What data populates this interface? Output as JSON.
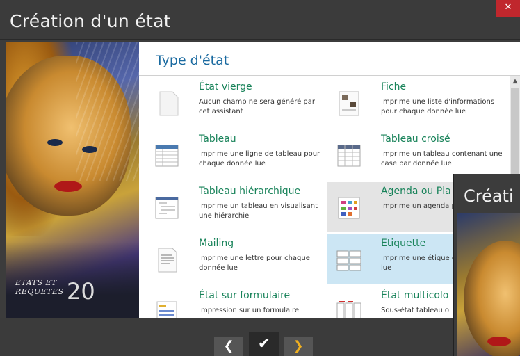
{
  "window": {
    "title": "Création d'un état",
    "close_icon": "close-icon"
  },
  "sidebar": {
    "logo_line1": "ETATS ET",
    "logo_line2": "REQUETES",
    "logo_version": "20"
  },
  "main": {
    "heading": "Type d'état",
    "items": [
      {
        "name": "État vierge",
        "desc": "Aucun champ ne sera généré par cet assistant",
        "icon": "blank-page-icon",
        "state": "normal"
      },
      {
        "name": "Fiche",
        "desc": "Imprime une liste d'informations pour chaque donnée lue",
        "icon": "form-card-icon",
        "state": "normal"
      },
      {
        "name": "Tableau",
        "desc": "Imprime une ligne de tableau pour chaque donnée lue",
        "icon": "table-icon",
        "state": "normal"
      },
      {
        "name": "Tableau croisé",
        "desc": "Imprime un tableau contenant une case par donnée lue",
        "icon": "cross-table-icon",
        "state": "normal"
      },
      {
        "name": "Tableau hiérarchique",
        "desc": "Imprime un tableau en visualisant une hiérarchie",
        "icon": "hierarchy-table-icon",
        "state": "normal"
      },
      {
        "name": "Agenda ou Pla",
        "desc": "Imprime un agenda planning",
        "icon": "agenda-icon",
        "state": "hover"
      },
      {
        "name": "Mailing",
        "desc": "Imprime une lettre pour chaque donnée lue",
        "icon": "letter-icon",
        "state": "normal"
      },
      {
        "name": "Etiquette",
        "desc": "Imprime une étique chaque donnée lue",
        "icon": "labels-icon",
        "state": "selected"
      },
      {
        "name": "État sur formulaire",
        "desc": "Impression sur un formulaire",
        "icon": "form-icon",
        "state": "normal"
      },
      {
        "name": "État multicolo",
        "desc": "Sous-état tableau o",
        "icon": "multicolumn-icon",
        "state": "normal"
      }
    ]
  },
  "nav": {
    "prev_label": "❮",
    "ok_label": "✔",
    "next_label": "❯"
  },
  "overlay": {
    "title": "Créati"
  },
  "colors": {
    "accent_title": "#1a6aa0",
    "item_name": "#19835a",
    "selected_bg": "#cce6f4",
    "hover_bg": "#e4e4e4",
    "close_bg": "#c0272d",
    "next_arrow": "#f0b020"
  }
}
